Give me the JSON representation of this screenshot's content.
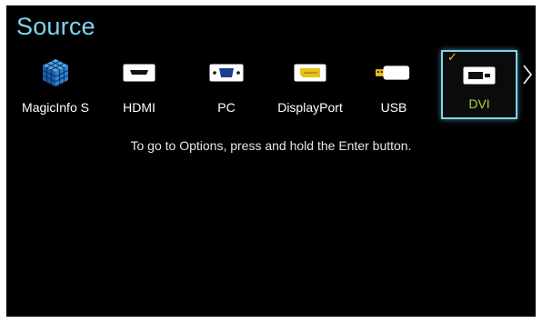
{
  "header": {
    "title": "Source"
  },
  "sources": [
    {
      "label": "MagicInfo S",
      "icon": "magicinfo-cube-icon",
      "selected": false
    },
    {
      "label": "HDMI",
      "icon": "hdmi-port-icon",
      "selected": false
    },
    {
      "label": "PC",
      "icon": "pc-vga-port-icon",
      "selected": false
    },
    {
      "label": "DisplayPort",
      "icon": "displayport-icon",
      "selected": false
    },
    {
      "label": "USB",
      "icon": "usb-drive-icon",
      "selected": false
    },
    {
      "label": "DVI",
      "icon": "dvi-port-icon",
      "selected": true
    }
  ],
  "hint": {
    "text": "To go to Options, press and hold the Enter button."
  },
  "colors": {
    "background": "#000000",
    "title": "#7fd3f0",
    "selected_border": "#7fd3f0",
    "selected_label": "#a7d44a",
    "checkmark": "#f3c21a",
    "displayport_accent": "#e8c21a"
  }
}
